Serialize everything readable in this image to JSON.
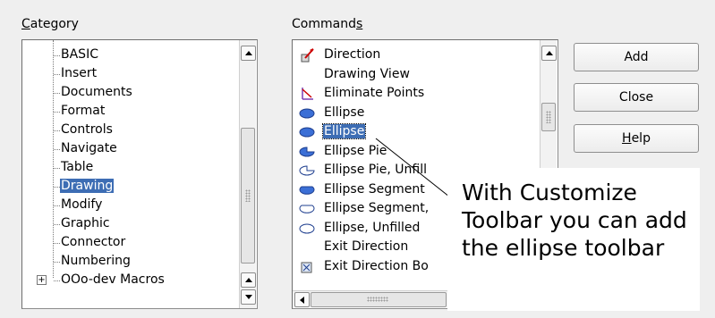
{
  "category": {
    "label_underlined": "C",
    "label_rest": "ategory",
    "items": [
      {
        "label": "BASIC"
      },
      {
        "label": "Insert"
      },
      {
        "label": "Documents"
      },
      {
        "label": "Format"
      },
      {
        "label": "Controls"
      },
      {
        "label": "Navigate"
      },
      {
        "label": "Table"
      },
      {
        "label": "Drawing",
        "selected": true
      },
      {
        "label": "Modify"
      },
      {
        "label": "Graphic"
      },
      {
        "label": "Connector"
      },
      {
        "label": "Numbering"
      },
      {
        "label": "OOo-dev Macros",
        "expander": "+"
      }
    ]
  },
  "commands": {
    "label_main": "Command",
    "label_underlined": "s",
    "items": [
      {
        "label": "Direction",
        "icon": "direction-icon"
      },
      {
        "label": "Drawing View",
        "icon": ""
      },
      {
        "label": "Eliminate Points",
        "icon": "eliminate-points-icon"
      },
      {
        "label": "Ellipse",
        "icon": "ellipse-filled-icon"
      },
      {
        "label": "Ellipse",
        "icon": "ellipse-filled-icon",
        "selected": true
      },
      {
        "label": "Ellipse Pie",
        "icon": "ellipse-pie-icon"
      },
      {
        "label": "Ellipse Pie, Unfill",
        "icon": "ellipse-pie-unfilled-icon"
      },
      {
        "label": "Ellipse Segment",
        "icon": "ellipse-segment-icon"
      },
      {
        "label": "Ellipse Segment,",
        "icon": "ellipse-segment-unfilled-icon"
      },
      {
        "label": "Ellipse, Unfilled",
        "icon": "ellipse-unfilled-icon"
      },
      {
        "label": "Exit Direction",
        "icon": ""
      },
      {
        "label": "Exit Direction Bo",
        "icon": "exit-direction-box-icon"
      }
    ]
  },
  "buttons": {
    "add": "Add",
    "close": "Close",
    "help_underlined": "H",
    "help_rest": "elp"
  },
  "callout": {
    "text": "With Customize Toolbar you can add the ellipse toolbar"
  },
  "colors": {
    "selection": "#3d6db4",
    "icon_blue": "#3b6fd6",
    "dialog_bg": "#efefef"
  }
}
